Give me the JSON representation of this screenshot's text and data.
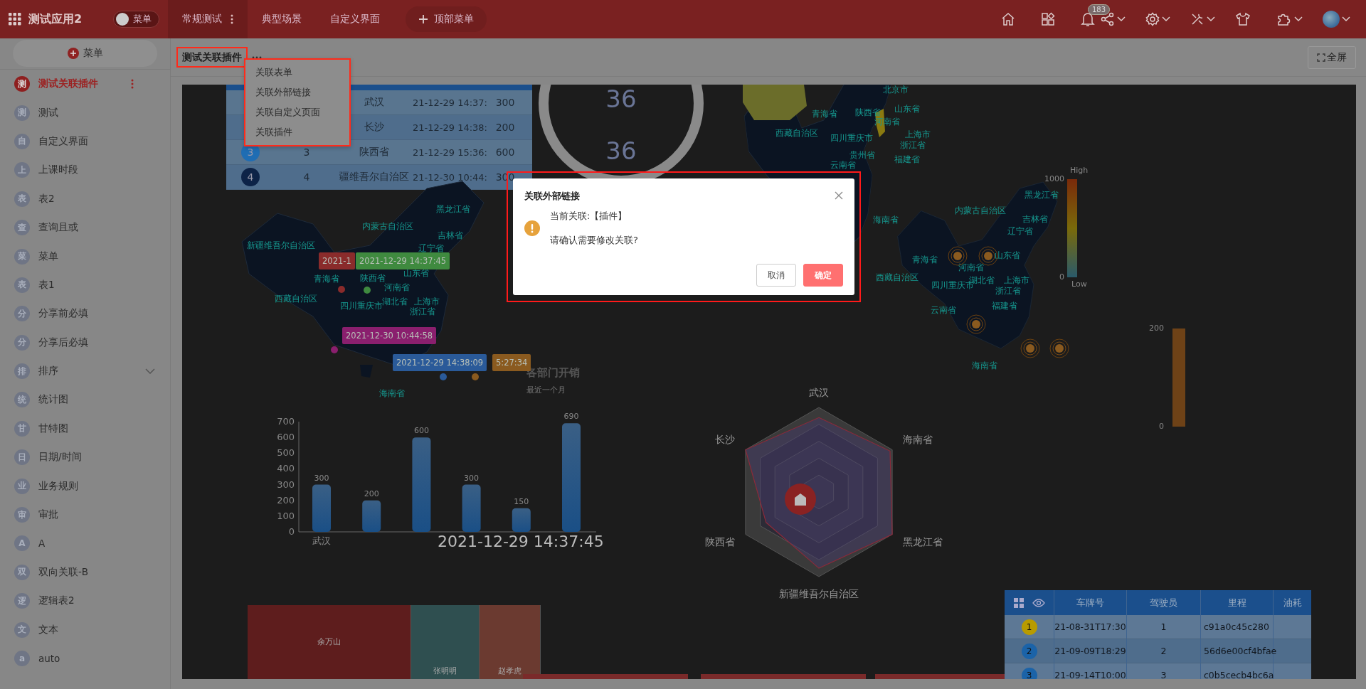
{
  "app": {
    "title": "测试应用2",
    "menu_toggle": {
      "label": "菜单",
      "on": false
    }
  },
  "nav": [
    {
      "label": "常规测试",
      "selected": true
    },
    {
      "label": "典型场景",
      "selected": false
    },
    {
      "label": "自定义界面",
      "selected": false
    }
  ],
  "add_top_menu": "顶部菜单",
  "notifications": {
    "count": "183"
  },
  "sidebar": {
    "add_label": "菜单",
    "items": [
      {
        "badge": "测",
        "label": "测试关联插件",
        "selected": true,
        "kind": "page"
      },
      {
        "badge": "测",
        "label": "测试",
        "selected": false,
        "kind": "page"
      },
      {
        "badge": "自",
        "label": "自定义界面",
        "selected": false,
        "kind": "page"
      },
      {
        "badge": "上",
        "label": "上课时段",
        "selected": false,
        "kind": "page"
      },
      {
        "badge": "表",
        "label": "表2",
        "selected": false,
        "kind": "page"
      },
      {
        "badge": "查",
        "label": "查询且或",
        "selected": false,
        "kind": "page"
      },
      {
        "badge": "菜",
        "label": "菜单",
        "selected": false,
        "kind": "page"
      },
      {
        "badge": "表",
        "label": "表1",
        "selected": false,
        "kind": "page"
      },
      {
        "badge": "分",
        "label": "分享前必填",
        "selected": false,
        "kind": "page"
      },
      {
        "badge": "分",
        "label": "分享后必填",
        "selected": false,
        "kind": "page"
      },
      {
        "badge": "排",
        "label": "排序",
        "selected": false,
        "kind": "group"
      },
      {
        "badge": "统",
        "label": "统计图",
        "selected": false,
        "kind": "page"
      },
      {
        "badge": "甘",
        "label": "甘特图",
        "selected": false,
        "kind": "page"
      },
      {
        "badge": "日",
        "label": "日期/时间",
        "selected": false,
        "kind": "page"
      },
      {
        "badge": "业",
        "label": "业务规则",
        "selected": false,
        "kind": "page"
      },
      {
        "badge": "审",
        "label": "审批",
        "selected": false,
        "kind": "page"
      },
      {
        "badge": "A",
        "label": "A",
        "selected": false,
        "kind": "page"
      },
      {
        "badge": "双",
        "label": "双向关联-B",
        "selected": false,
        "kind": "page"
      },
      {
        "badge": "逻",
        "label": "逻辑表2",
        "selected": false,
        "kind": "page"
      },
      {
        "badge": "文",
        "label": "文本",
        "selected": false,
        "kind": "page"
      },
      {
        "badge": "a",
        "label": "auto",
        "selected": false,
        "kind": "page"
      }
    ]
  },
  "tabs": [
    {
      "label": "测试关联插件",
      "selected": true
    }
  ],
  "fullscreen": "全屏",
  "context_menu": [
    "关联表单",
    "关联外部链接",
    "关联自定义页面",
    "关联插件"
  ],
  "dashboard": {
    "rank_table": {
      "rows": [
        {
          "place": "武汉",
          "time": "21-12-29 14:37:",
          "value": "300"
        },
        {
          "place": "长沙",
          "time": "21-12-29 14:38:",
          "value": "200"
        },
        {
          "rank": "3",
          "color": "#1f6db3",
          "index": "3",
          "place": "陕西省",
          "time": "21-12-29 15:36:",
          "value": "600"
        },
        {
          "rank": "4",
          "color": "#0d2347",
          "index": "4",
          "place": "疆维吾尔自治区",
          "time": "21-12-30 10:44:",
          "value": "300"
        }
      ]
    },
    "gauge": {
      "values": [
        "36",
        "36"
      ]
    },
    "map_left": {
      "labels": [
        "黑龙江省",
        "内蒙古自治区",
        "吉林省",
        "新疆维吾尔自治区",
        "辽宁省",
        "青海省",
        "山东省",
        "陕西省",
        "河南省",
        "西藏自治区",
        "湖北省",
        "上海市",
        "四川重庆市",
        "浙江省",
        "海南省"
      ],
      "tags": [
        {
          "text": "2021-1",
          "color": "#8a2b2b"
        },
        {
          "text": "2021-12-29 14:37:45",
          "color": "#3f8a3f"
        },
        {
          "text": "2021-12-30 10:44:58",
          "color": "#8a1f6e"
        },
        {
          "text": "2021-12-29 14:38:09",
          "color": "#2a5a99"
        },
        {
          "text": "5:27:34",
          "color": "#8a5a1f"
        }
      ]
    },
    "map_right": {
      "labels": [
        "青海省",
        "西藏自治区",
        "四川重庆市",
        "山东省",
        "陕西省",
        "河南省",
        "上海市",
        "浙江省",
        "福建省",
        "贵州省",
        "云南省",
        "北京市",
        "海南省",
        "黑龙江省",
        "内蒙古自治区",
        "吉林省",
        "辽宁省",
        "青海省",
        "山东省",
        "河南省",
        "西藏自治区",
        "四川重庆市",
        "湖北省",
        "上海市",
        "浙江省",
        "福建省",
        "云南省",
        "海南省"
      ],
      "legend": {
        "high": "High",
        "max": "1000",
        "min": "0",
        "low": "Low"
      }
    },
    "legend_bar": {
      "max": "200",
      "min": "0"
    },
    "bar_chart": {
      "title": "各部门开销",
      "subtitle": "最近一个月",
      "chart_data": {
        "type": "bar",
        "categories": [
          "武汉",
          null,
          null,
          null,
          null,
          null
        ],
        "values": [
          300,
          200,
          600,
          300,
          150,
          690
        ],
        "ylim": [
          0,
          700
        ],
        "yticks": [
          0,
          100,
          200,
          300,
          400,
          500,
          600,
          700
        ],
        "data_labels": true
      }
    },
    "timestamp": "2021-12-29 14:37:45",
    "radar": {
      "labels": [
        "武汉",
        "海南省",
        "黑龙江省",
        "新疆维吾尔自治区",
        "陕西省",
        "长沙"
      ]
    },
    "treemap": [
      {
        "name": "余万山",
        "color": "#5e1d1d"
      },
      {
        "name": "张明明",
        "color": "#2f4f50"
      },
      {
        "name": "赵孝虎",
        "color": "#6b3a30"
      }
    ],
    "vehicle_table": {
      "columns": [
        "车牌号",
        "驾驶员",
        "里程",
        "油耗"
      ],
      "rows": [
        {
          "rank": "1",
          "color": "#b89b00",
          "time": "21-08-31T17:30",
          "driver": "1",
          "mileage": "c91a0c45c280"
        },
        {
          "rank": "2",
          "color": "#1b63a8",
          "time": "21-09-09T18:29",
          "driver": "2",
          "mileage": "56d6e00cf4bfae"
        },
        {
          "rank": "3",
          "color": "#1b63a8",
          "time": "21-09-14T10:00",
          "driver": "3",
          "mileage": "c0b5cecb4bc6a"
        }
      ]
    }
  },
  "dialog": {
    "title": "关联外部链接",
    "lines": [
      "当前关联:【插件】",
      "请确认需要修改关联?"
    ],
    "buttons": [
      {
        "label": "取消",
        "kind": "secondary"
      },
      {
        "label": "确定",
        "kind": "primary"
      }
    ]
  }
}
